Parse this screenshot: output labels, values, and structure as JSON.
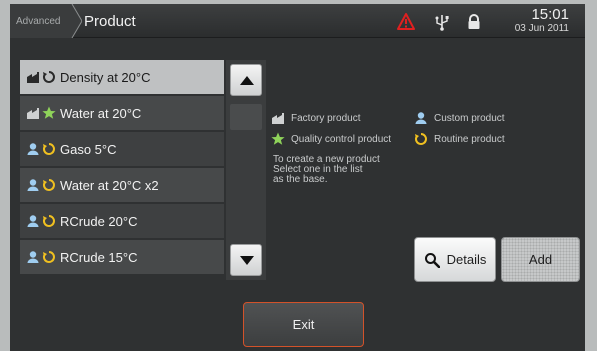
{
  "header": {
    "breadcrumb_parent": "Advanced",
    "title": "Product",
    "time": "15:01",
    "date": "03 Jun 2011",
    "icons": [
      "warning-icon",
      "usb-icon",
      "lock-icon"
    ]
  },
  "products": [
    {
      "label": "Density at 20°C",
      "icons": [
        "factory-icon",
        "routine-icon"
      ],
      "selected": true
    },
    {
      "label": "Water at 20°C",
      "icons": [
        "factory-icon",
        "star-icon"
      ],
      "selected": false
    },
    {
      "label": "Gaso 5°C",
      "icons": [
        "user-icon",
        "routine-icon"
      ],
      "selected": false
    },
    {
      "label": "Water at 20°C x2",
      "icons": [
        "user-icon",
        "routine-icon"
      ],
      "selected": false
    },
    {
      "label": "RCrude 20°C",
      "icons": [
        "user-icon",
        "routine-icon"
      ],
      "selected": false
    },
    {
      "label": "RCrude 15°C",
      "icons": [
        "user-icon",
        "routine-icon"
      ],
      "selected": false
    }
  ],
  "legend": {
    "factory": "Factory product",
    "custom": "Custom product",
    "quality": "Quality control product",
    "routine": "Routine product"
  },
  "hint": {
    "line1": "To create a new product",
    "line2": "Select one in the list",
    "line3": "as the base."
  },
  "buttons": {
    "details": "Details",
    "add": "Add",
    "exit": "Exit"
  },
  "colors": {
    "accent_exit_border": "#d2522a",
    "warning": "#e02020",
    "routine": "#f0c020",
    "quality_star": "#8fd35a",
    "custom_user": "#9fcdf0"
  }
}
